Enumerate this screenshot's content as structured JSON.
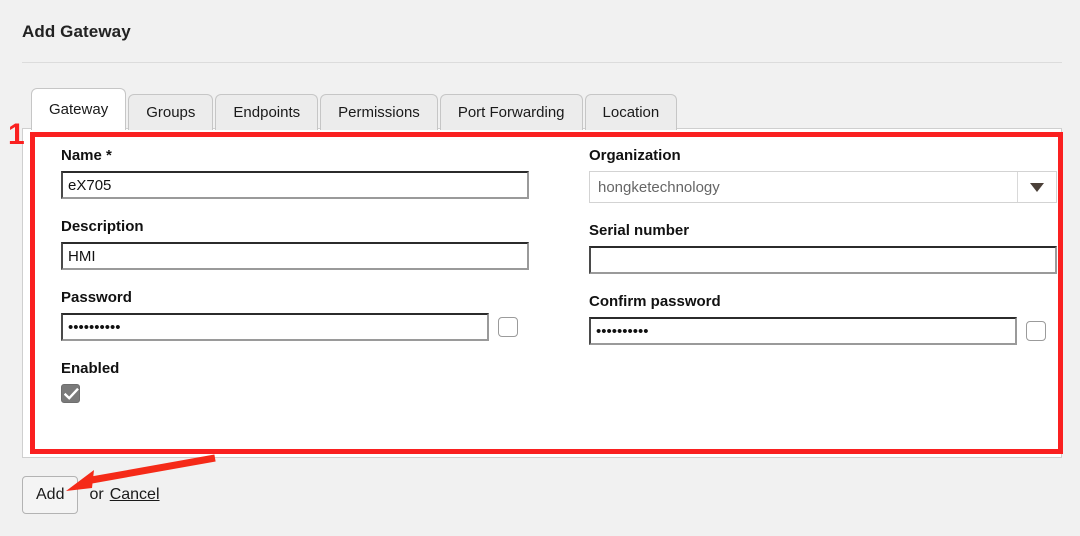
{
  "header": {
    "title": "Add Gateway"
  },
  "tabs": [
    {
      "label": "Gateway",
      "active": true
    },
    {
      "label": "Groups",
      "active": false
    },
    {
      "label": "Endpoints",
      "active": false
    },
    {
      "label": "Permissions",
      "active": false
    },
    {
      "label": "Port Forwarding",
      "active": false
    },
    {
      "label": "Location",
      "active": false
    }
  ],
  "form": {
    "name": {
      "label": "Name *",
      "value": "eX705",
      "placeholder": ""
    },
    "organization": {
      "label": "Organization",
      "value": "hongketechnology",
      "arrow_icon": "chevron-down-icon"
    },
    "description": {
      "label": "Description",
      "value": "HMI",
      "placeholder": ""
    },
    "serial_number": {
      "label": "Serial number",
      "value": "",
      "placeholder": ""
    },
    "password": {
      "label": "Password",
      "value": "••••••••••",
      "reveal_icon": "checkbox-unchecked-icon"
    },
    "confirm_password": {
      "label": "Confirm password",
      "value": "••••••••••",
      "reveal_icon": "checkbox-unchecked-icon"
    },
    "enabled": {
      "label": "Enabled",
      "checked": true,
      "icon": "checkbox-checked-icon"
    }
  },
  "actions": {
    "add_label": "Add",
    "or_label": "or",
    "cancel_label": "Cancel"
  },
  "annotations": {
    "step_number": "1",
    "highlight_color": "#fa2020",
    "arrow_icon": "arrow-pointer-icon"
  }
}
